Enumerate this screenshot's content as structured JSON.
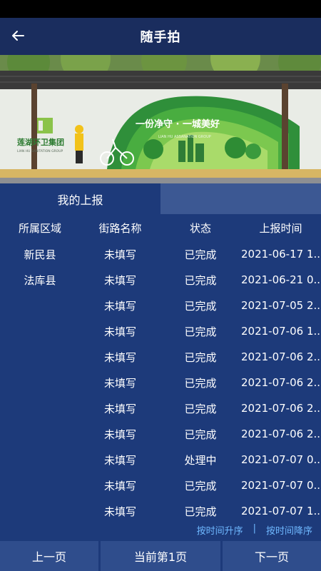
{
  "header": {
    "title": "随手拍"
  },
  "banner": {
    "brand_cn": "莲湖环卫集团",
    "brand_en": "LIAN HU SANITATION GROUP",
    "slogan": "一份净守 · 一城美好",
    "slogan_en": "LIAN HU ASSANATION GROUP"
  },
  "tabs": {
    "active_label": "我的上报"
  },
  "table": {
    "columns": [
      "所属区域",
      "街路名称",
      "状态",
      "上报时间"
    ],
    "rows": [
      {
        "area": "新民县",
        "street": "未填写",
        "status": "已完成",
        "time": "2021-06-17 1..."
      },
      {
        "area": "法库县",
        "street": "未填写",
        "status": "已完成",
        "time": "2021-06-21 0..."
      },
      {
        "area": "",
        "street": "未填写",
        "status": "已完成",
        "time": "2021-07-05 2..."
      },
      {
        "area": "",
        "street": "未填写",
        "status": "已完成",
        "time": "2021-07-06 1..."
      },
      {
        "area": "",
        "street": "未填写",
        "status": "已完成",
        "time": "2021-07-06 2..."
      },
      {
        "area": "",
        "street": "未填写",
        "status": "已完成",
        "time": "2021-07-06 2..."
      },
      {
        "area": "",
        "street": "未填写",
        "status": "已完成",
        "time": "2021-07-06 2..."
      },
      {
        "area": "",
        "street": "未填写",
        "status": "已完成",
        "time": "2021-07-06 2..."
      },
      {
        "area": "",
        "street": "未填写",
        "status": "处理中",
        "time": "2021-07-07 0..."
      },
      {
        "area": "",
        "street": "未填写",
        "status": "已完成",
        "time": "2021-07-07 0..."
      },
      {
        "area": "",
        "street": "未填写",
        "status": "已完成",
        "time": "2021-07-07 1..."
      }
    ]
  },
  "sort": {
    "asc": "按时间升序",
    "sep": "|",
    "desc": "按时间降序"
  },
  "pager": {
    "prev": "上一页",
    "current": "当前第1页",
    "next": "下一页"
  },
  "colors": {
    "background": "#1d3a7a",
    "header": "#1a2d5e",
    "link": "#6fb8ff"
  }
}
